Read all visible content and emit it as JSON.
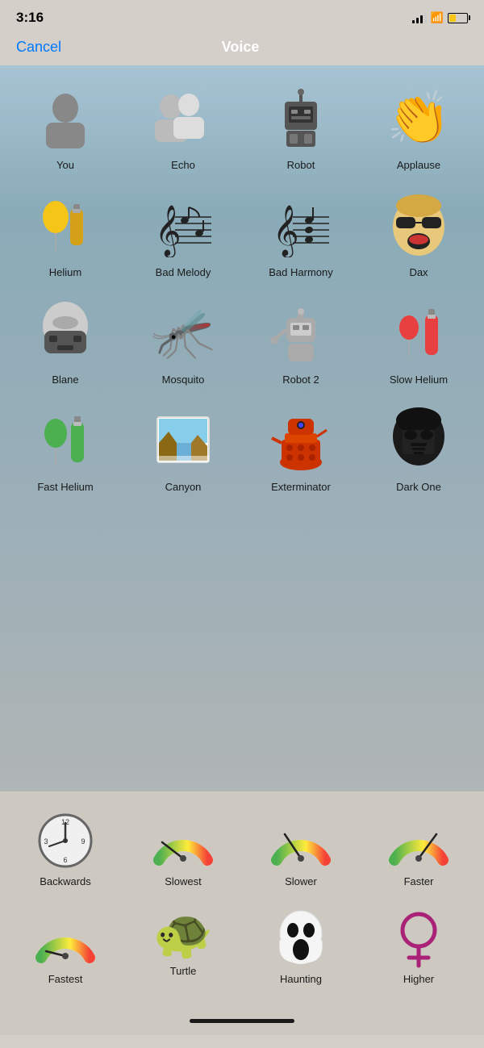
{
  "status": {
    "time": "3:16"
  },
  "nav": {
    "cancel": "Cancel",
    "title": "Voice"
  },
  "voices": [
    {
      "id": "you",
      "label": "You",
      "emoji": "🧍",
      "type": "person"
    },
    {
      "id": "echo",
      "label": "Echo",
      "emoji": "👥",
      "type": "echo"
    },
    {
      "id": "robot",
      "label": "Robot",
      "emoji": "🤖",
      "type": "robot"
    },
    {
      "id": "applause",
      "label": "Applause",
      "emoji": "👏",
      "type": "emoji"
    },
    {
      "id": "helium",
      "label": "Helium",
      "type": "helium"
    },
    {
      "id": "bad-melody",
      "label": "Bad Melody",
      "type": "music1"
    },
    {
      "id": "bad-harmony",
      "label": "Bad Harmony",
      "type": "music2"
    },
    {
      "id": "dax",
      "label": "Dax",
      "emoji": "😎",
      "type": "face"
    },
    {
      "id": "blane",
      "label": "Blane",
      "type": "mask"
    },
    {
      "id": "mosquito",
      "label": "Mosquito",
      "emoji": "🦟",
      "type": "emoji"
    },
    {
      "id": "robot2",
      "label": "Robot 2",
      "type": "robot2"
    },
    {
      "id": "slow-helium",
      "label": "Slow Helium",
      "type": "slow-helium"
    },
    {
      "id": "fast-helium",
      "label": "Fast Helium",
      "type": "fast-helium"
    },
    {
      "id": "canyon",
      "label": "Canyon",
      "type": "canyon"
    },
    {
      "id": "exterminator",
      "label": "Exterminator",
      "type": "dalek"
    },
    {
      "id": "dark-one",
      "label": "Dark One",
      "type": "darth"
    }
  ],
  "speeds": [
    {
      "id": "backwards",
      "label": "Backwards",
      "type": "clock"
    },
    {
      "id": "slowest",
      "label": "Slowest",
      "type": "gauge-slowest"
    },
    {
      "id": "slower",
      "label": "Slower",
      "type": "gauge-slower"
    },
    {
      "id": "faster",
      "label": "Faster",
      "type": "gauge-faster"
    }
  ],
  "bottom": [
    {
      "id": "fastest",
      "label": "Fastest",
      "type": "gauge-fastest"
    },
    {
      "id": "turtle",
      "label": "Turtle",
      "emoji": "🐢",
      "type": "emoji"
    },
    {
      "id": "haunting",
      "label": "Haunting",
      "type": "ghost"
    },
    {
      "id": "higher",
      "label": "Higher",
      "type": "female"
    }
  ]
}
